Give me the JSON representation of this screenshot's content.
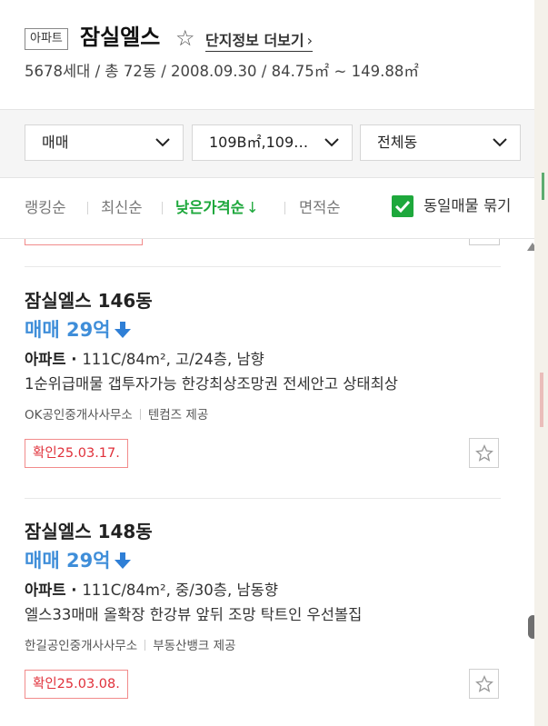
{
  "header": {
    "type_badge": "아파트",
    "complex_name": "잠실엘스",
    "more_link": "단지정보 더보기",
    "summary": "5678세대 / 총 72동 / 2008.09.30 / 84.75㎡ ~ 149.88㎡"
  },
  "filters": {
    "trade": "매매",
    "area": "109B㎡,109…",
    "building": "전체동"
  },
  "sort": {
    "ranking": "랭킹순",
    "latest": "최신순",
    "low_price": "낮은가격순",
    "low_price_arrow": "↓",
    "area": "면적순",
    "dedupe_label": "동일매물 묶기",
    "dedupe_checked": true
  },
  "listings": [
    {
      "title": "잠실엘스 146동",
      "price": "매매 29억",
      "kind": "아파트",
      "spec": "111C/84m², 고/24층, 남향",
      "desc": "1순위급매물 갭투자가능 한강최상조망권 전세안고 상태최상",
      "agent": "OK공인중개사사무소",
      "provider": "텐컴즈 제공",
      "confirm": "확인25.03.17."
    },
    {
      "title": "잠실엘스 148동",
      "price": "매매 29억",
      "kind": "아파트",
      "spec": "111C/84m², 중/30층, 남동향",
      "desc": "엘스33매매 올확장 한강뷰 앞뒤 조망 탁트인 우선볼집",
      "agent": "한길공인중개사사무소",
      "provider": "부동산뱅크 제공",
      "confirm": "확인25.03.08."
    }
  ],
  "colors": {
    "accent_green": "#1ea83c",
    "price_blue": "#3f8ed9",
    "confirm_red": "#e0303a"
  }
}
